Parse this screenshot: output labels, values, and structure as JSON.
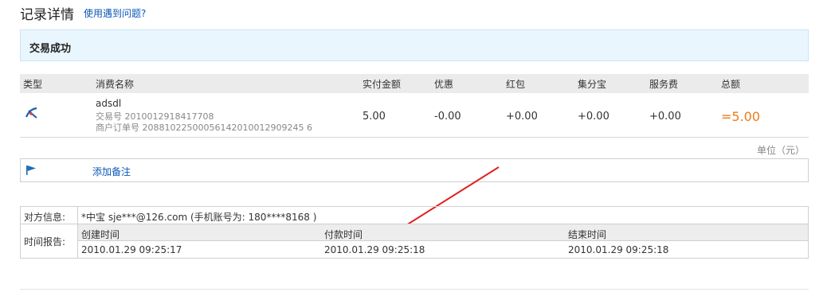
{
  "header": {
    "title": "记录详情",
    "help_link": "使用遇到问题?"
  },
  "status": {
    "text": "交易成功"
  },
  "table": {
    "columns": [
      "类型",
      "消费名称",
      "实付金额",
      "优惠",
      "红包",
      "集分宝",
      "服务费",
      "总额"
    ],
    "row": {
      "type_icon": "alipay-icon",
      "name": "adsdl",
      "trade_no": "交易号 2010012918417708",
      "order_no": "商户订单号 20881022500056142010012909245 6",
      "paid": "5.00",
      "discount": "-0.00",
      "red_packet": "+0.00",
      "jifenbao": "+0.00",
      "service_fee": "+0.00",
      "total": "=5.00"
    },
    "unit_label": "单位（元）"
  },
  "note": {
    "icon": "flag-icon",
    "label": "添加备注"
  },
  "info": {
    "counterparty_label": "对方信息:",
    "counterparty_value": "*中宝 sje***@126.com (手机账号为: 180****8168 )",
    "time_label": "时间报告:",
    "time_headers": [
      "创建时间",
      "付款时间",
      "结束时间"
    ],
    "time_values": [
      "2010.01.29 09:25:17",
      "2010.01.29 09:25:18",
      "2010.01.29 09:25:18"
    ]
  },
  "colors": {
    "link": "#0a57b5",
    "total": "#f07b17",
    "status_bg": "#e9f6fd",
    "annotation_arrow": "#e02020"
  }
}
